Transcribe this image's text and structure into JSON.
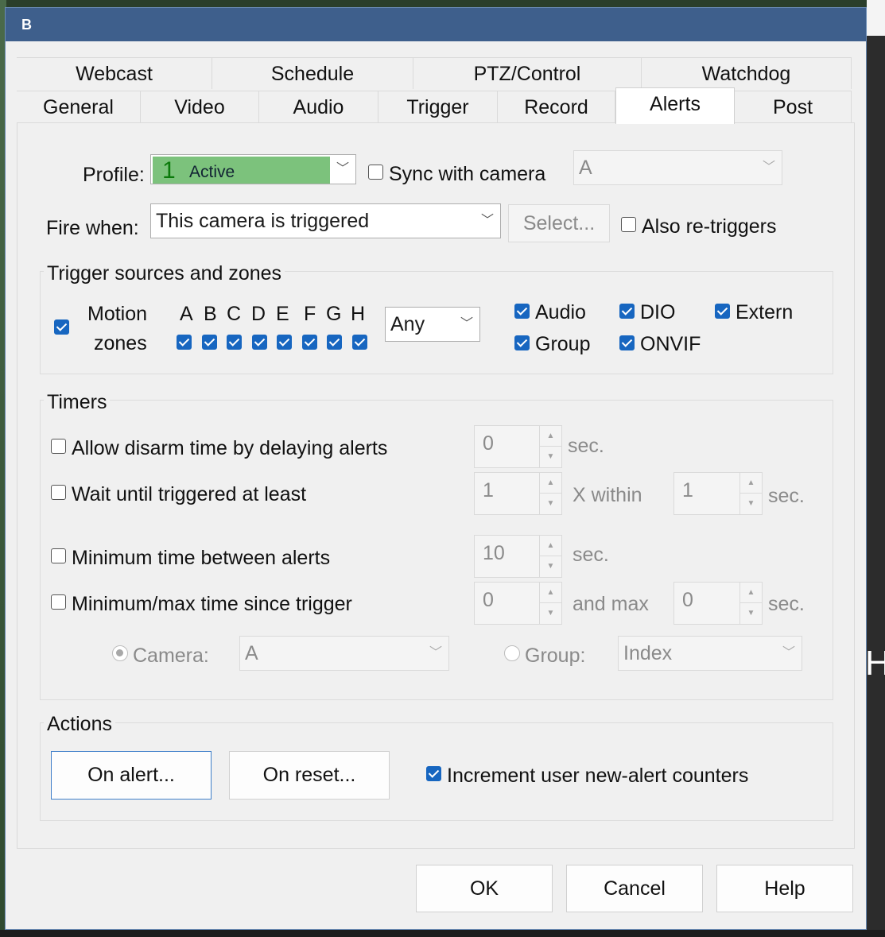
{
  "window": {
    "title": "B"
  },
  "background": {
    "edge_text": "H"
  },
  "tabs_row1": [
    "Webcast",
    "Schedule",
    "PTZ/Control",
    "Watchdog"
  ],
  "tabs_row2": [
    "General",
    "Video",
    "Audio",
    "Trigger",
    "Record",
    "Alerts",
    "Post"
  ],
  "active_tab": "Alerts",
  "profile": {
    "label": "Profile:",
    "number": "1",
    "value": "Active",
    "color": "#7cc27c"
  },
  "sync": {
    "label": "Sync with camera",
    "checked": false,
    "camera_value": "A"
  },
  "fire_when": {
    "label": "Fire when:",
    "value": "This camera is triggered",
    "select_label": "Select...",
    "retrigger_label": "Also re-triggers",
    "retrigger_checked": false
  },
  "trigger_sources": {
    "title": "Trigger sources and zones",
    "motion_label_1": "Motion",
    "motion_label_2": "zones",
    "motion_checked": true,
    "zones": [
      {
        "letter": "A",
        "checked": true
      },
      {
        "letter": "B",
        "checked": true
      },
      {
        "letter": "C",
        "checked": true
      },
      {
        "letter": "D",
        "checked": true
      },
      {
        "letter": "E",
        "checked": true
      },
      {
        "letter": "F",
        "checked": true
      },
      {
        "letter": "G",
        "checked": true
      },
      {
        "letter": "H",
        "checked": true
      }
    ],
    "any_value": "Any",
    "sources": [
      {
        "label": "Audio",
        "checked": true
      },
      {
        "label": "DIO",
        "checked": true
      },
      {
        "label": "Extern",
        "checked": true
      },
      {
        "label": "Group",
        "checked": true
      },
      {
        "label": "ONVIF",
        "checked": true
      }
    ]
  },
  "timers": {
    "title": "Timers",
    "disarm": {
      "label": "Allow disarm time by delaying alerts",
      "checked": false,
      "value": "0",
      "unit": "sec."
    },
    "wait": {
      "label": "Wait until triggered at least",
      "checked": false,
      "value": "1",
      "mid": "X within",
      "value2": "1",
      "unit": "sec."
    },
    "min_between": {
      "label": "Minimum time between alerts",
      "checked": false,
      "value": "10",
      "unit": "sec."
    },
    "min_max": {
      "label": "Minimum/max time since trigger",
      "checked": false,
      "value": "0",
      "mid": "and max",
      "value2": "0",
      "unit": "sec."
    },
    "camera_label": "Camera:",
    "camera_value": "A",
    "group_label": "Group:",
    "group_value": "Index"
  },
  "actions": {
    "title": "Actions",
    "on_alert": "On alert...",
    "on_reset": "On reset...",
    "increment_label": "Increment user new-alert counters",
    "increment_checked": true
  },
  "footer": {
    "ok": "OK",
    "cancel": "Cancel",
    "help": "Help"
  },
  "colors": {
    "titlebar": "#3e5f8c",
    "checkbox_on": "#1766c0"
  }
}
